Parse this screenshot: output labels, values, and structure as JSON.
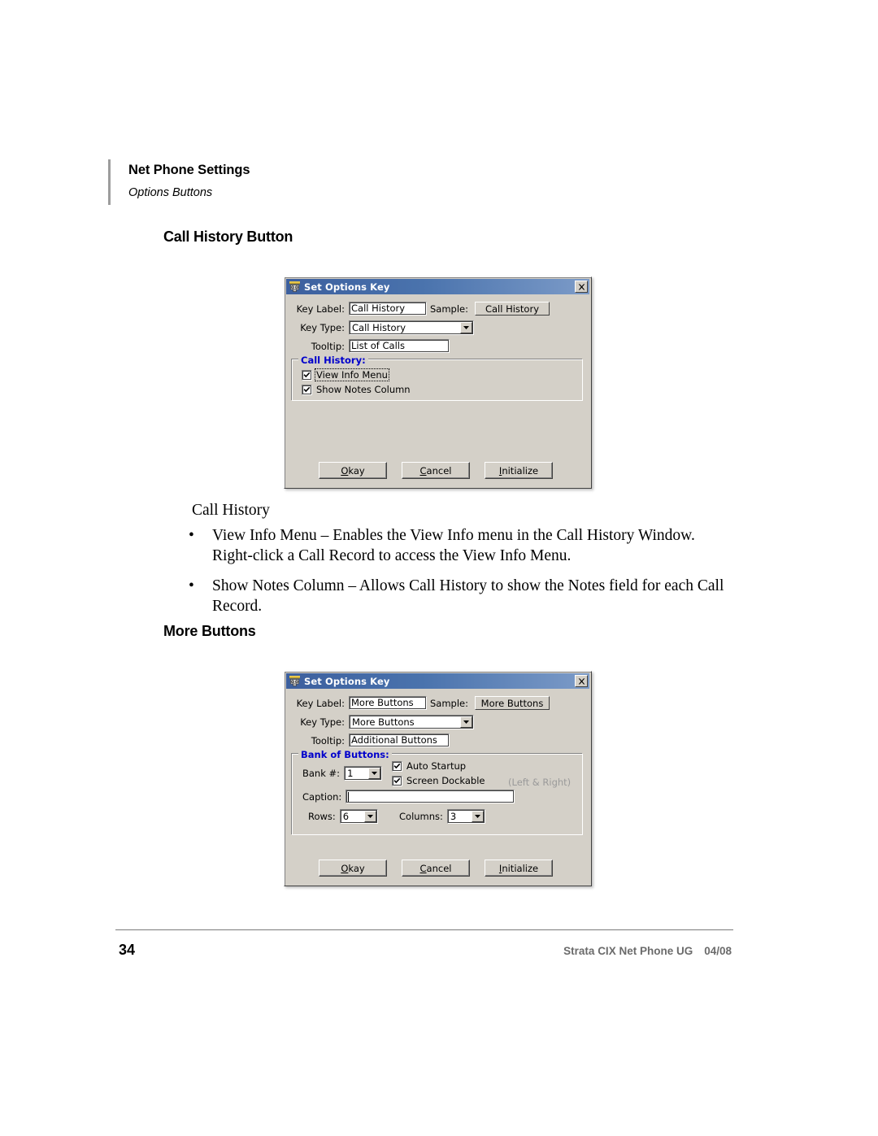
{
  "header": {
    "title": "Net Phone Settings",
    "subtitle": "Options Buttons"
  },
  "sections": [
    {
      "heading": "Call History Button"
    },
    {
      "heading": "More Buttons"
    }
  ],
  "body": {
    "intro": "Call History",
    "bullets": [
      "View Info Menu – Enables the View Info menu in the Call History Window. Right-click a Call Record to access the View Info Menu.",
      "Show Notes Column – Allows Call History to show the Notes field for each Call Record."
    ],
    "bullet_glyph": "•"
  },
  "dialog_call_history": {
    "title": "Set Options Key",
    "icon": "telephone-icon",
    "close_label": "x",
    "labels": {
      "key_label": "Key Label:",
      "key_type": "Key Type:",
      "tooltip": "Tooltip:",
      "sample": "Sample:"
    },
    "values": {
      "key_label": "Call History",
      "key_type": "Call History",
      "tooltip": "List of Calls",
      "sample_button": "Call History"
    },
    "group": {
      "label": "Call History:",
      "checkboxes": [
        {
          "label": "View Info Menu",
          "checked": true,
          "focused": true
        },
        {
          "label": "Show Notes Column",
          "checked": true,
          "focused": false
        }
      ]
    },
    "buttons": {
      "okay": "Okay",
      "cancel": "Cancel",
      "initialize": "Initialize"
    }
  },
  "dialog_more_buttons": {
    "title": "Set Options Key",
    "icon": "telephone-icon",
    "close_label": "x",
    "labels": {
      "key_label": "Key Label:",
      "key_type": "Key Type:",
      "tooltip": "Tooltip:",
      "sample": "Sample:",
      "bank_number": "Bank #:",
      "caption": "Caption:",
      "rows": "Rows:",
      "columns": "Columns:"
    },
    "values": {
      "key_label": "More Buttons",
      "key_type": "More Buttons",
      "tooltip": "Additional Buttons",
      "sample_button": "More Buttons",
      "bank_number": "1",
      "caption": "",
      "rows": "6",
      "columns": "3"
    },
    "group": {
      "label": "Bank of Buttons:",
      "checkboxes": [
        {
          "label": "Auto Startup",
          "checked": true
        },
        {
          "label": "Screen Dockable",
          "checked": true
        }
      ],
      "hint": "(Left & Right)"
    },
    "buttons": {
      "okay": "Okay",
      "cancel": "Cancel",
      "initialize": "Initialize"
    }
  },
  "footer": {
    "page_number": "34",
    "doc_title": "Strata CIX Net Phone UG",
    "doc_date": "04/08"
  },
  "colors": {
    "titlebar_blue": "#4a73ad",
    "dialog_face": "#d4d0c8",
    "group_label_blue": "#0000cc",
    "hint_gray": "#9a9a9a",
    "footer_gray": "#6b6b6b"
  }
}
